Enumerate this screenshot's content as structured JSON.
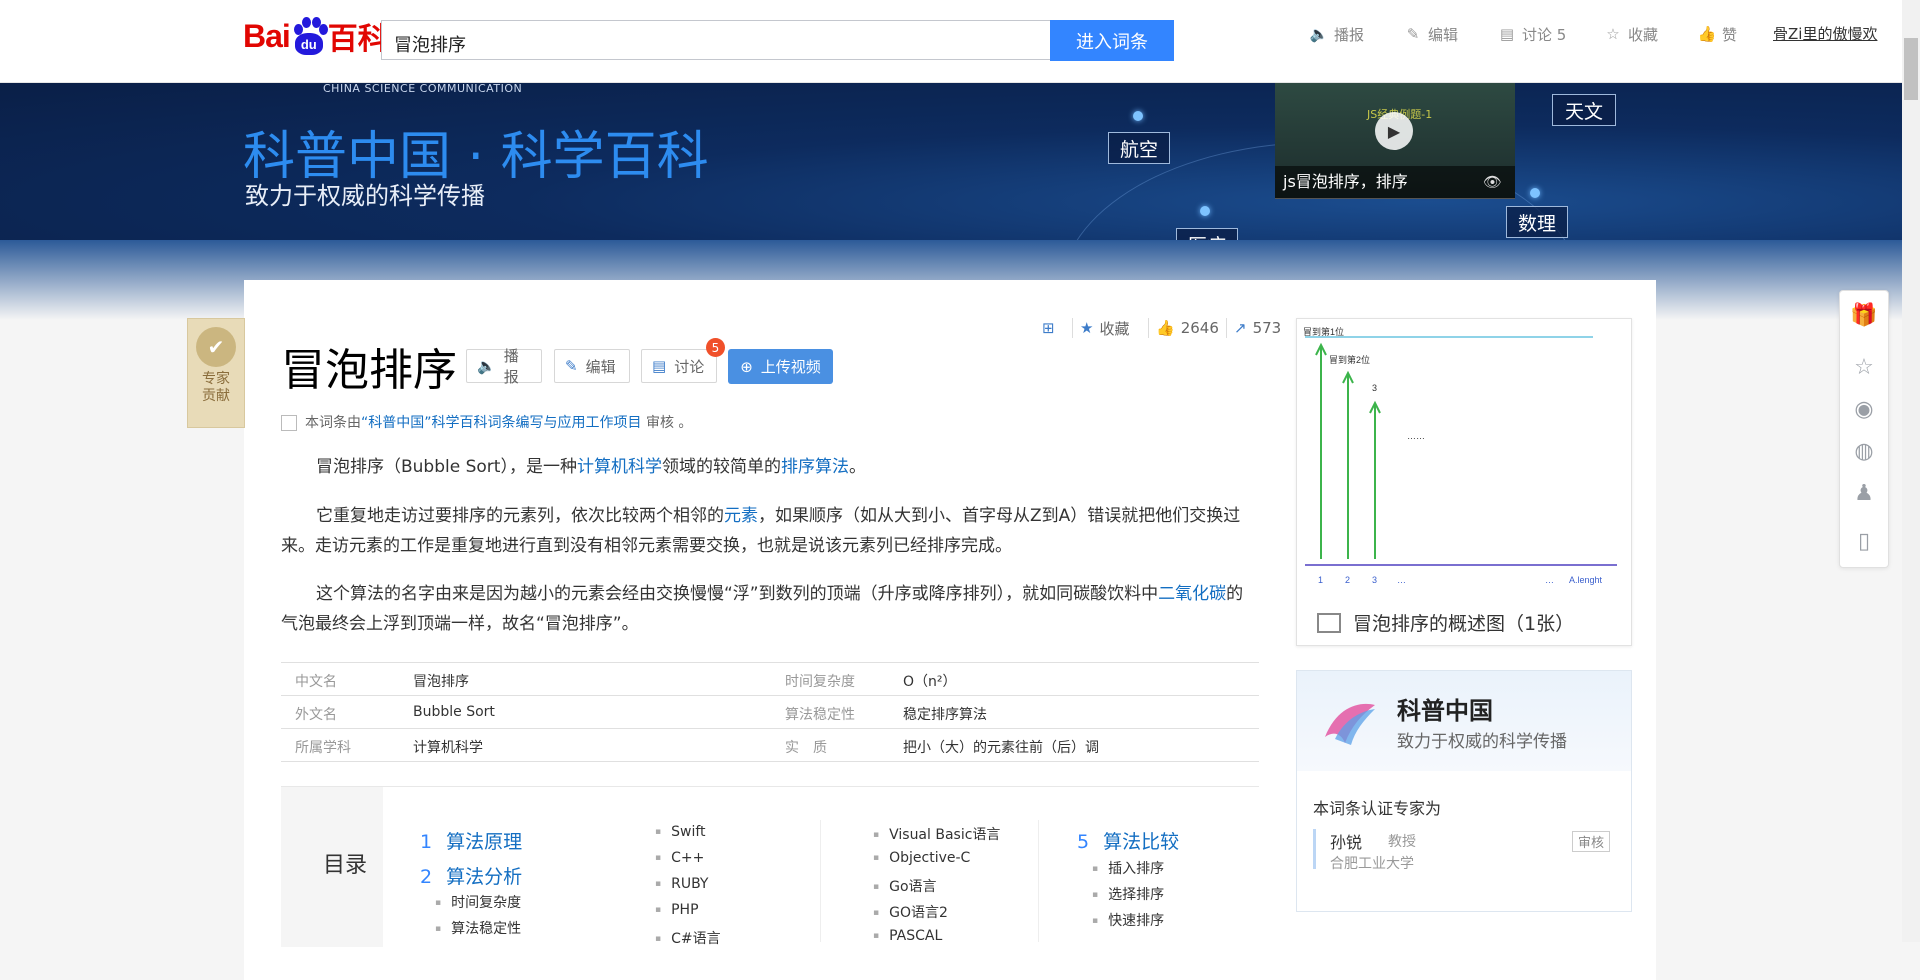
{
  "header": {
    "logo_bai": "Bai",
    "logo_du": "du",
    "logo_baike": "百科",
    "search_value": "冒泡排序",
    "search_button": "进入词条",
    "links": [
      {
        "label": "播报",
        "icon": "speaker-icon"
      },
      {
        "label": "编辑",
        "icon": "pencil-icon"
      },
      {
        "label": "讨论 5",
        "icon": "comment-icon"
      },
      {
        "label": "收藏",
        "icon": "star-icon"
      },
      {
        "label": "赞",
        "icon": "thumb-up-icon"
      }
    ],
    "user": "骨Zi里的傲慢欢"
  },
  "banner": {
    "small": "CHINA SCIENCE COMMUNICATION",
    "title": "科普中国 · 科学百科",
    "subtitle": "致力于权威的科学传播",
    "tags": [
      "航空",
      "医疗",
      "天文",
      "数理"
    ],
    "video_caption": "js冒泡排序，排序",
    "video_overlay": "JS经典例题-1"
  },
  "entry": {
    "title": "冒泡排序",
    "buttons": {
      "broadcast": "播报",
      "edit": "编辑",
      "discuss": "讨论",
      "discuss_badge": "5",
      "upload": "上传视频"
    },
    "tools": {
      "collect": "收藏",
      "likes": "2646",
      "shares": "573"
    },
    "review_prefix": "本词条由",
    "review_link": "“科普中国”科学百科词条编写与应用工作项目",
    "review_suffix": " 审核 。",
    "p1": [
      "冒泡排序（Bubble Sort），是一种",
      "计算机科学",
      "领域的较简单的",
      "排序算法",
      "。"
    ],
    "p2": [
      "它重复地走访过要排序的元素列，依次比较两个相邻的",
      "元素",
      "，如果顺序（如从大到小、首字母从Z到A）错误就把他们交换过来。走访元素的工作是重复地进行直到没有相邻元素需要交换，也就是说该元素列已经排序完成。"
    ],
    "p3": [
      "这个算法的名字由来是因为越小的元素会经由交换慢慢“浮”到数列的顶端（升序或降序排列），就如同碳酸饮料中",
      "二氧化碳",
      "的气泡最终会上浮到顶端一样，故名“冒泡排序”。"
    ]
  },
  "infobox": [
    {
      "k1": "中文名",
      "v1": "冒泡排序",
      "k2": "时间复杂度",
      "v2": "O（n²）"
    },
    {
      "k1": "外文名",
      "v1": "Bubble Sort",
      "k2": "算法稳定性",
      "v2": "稳定排序算法"
    },
    {
      "k1": "所属学科",
      "v1": "计算机科学",
      "k2": "实　质",
      "v2": "把小（大）的元素往前（后）调"
    }
  ],
  "toc": {
    "label": "目录",
    "l1": [
      {
        "num": "1",
        "text": "算法原理"
      },
      {
        "num": "2",
        "text": "算法分析"
      },
      {
        "num": "5",
        "text": "算法比较"
      }
    ],
    "col1": [
      "时间复杂度",
      "算法稳定性"
    ],
    "col2": [
      "Swift",
      "C++",
      "RUBY",
      "PHP",
      "C#语言"
    ],
    "col3": [
      "Visual Basic语言",
      "Objective-C",
      "Go语言",
      "GO语言2",
      "PASCAL"
    ],
    "col4": [
      "插入排序",
      "选择排序",
      "快速排序"
    ]
  },
  "album": {
    "caption": "冒泡排序的概述图（1张）",
    "diagram_labels": [
      "冒到第1位",
      "冒到第2位",
      "3",
      "……",
      "1",
      "2",
      "3",
      "…",
      "…",
      "A.lenght"
    ]
  },
  "kepu": {
    "name": "科普中国",
    "desc": "致力于权威的科学传播",
    "cert": "本词条认证专家为",
    "expert_name": "孙锐",
    "expert_title": "教授",
    "expert_unit": "合肥工业大学",
    "review_tag": "审核"
  },
  "expert_side": "专家贡献",
  "share_icons": [
    "gift-icon",
    "star-icon",
    "weibo-icon",
    "wechat-icon",
    "qq-icon",
    "mobile-icon"
  ]
}
